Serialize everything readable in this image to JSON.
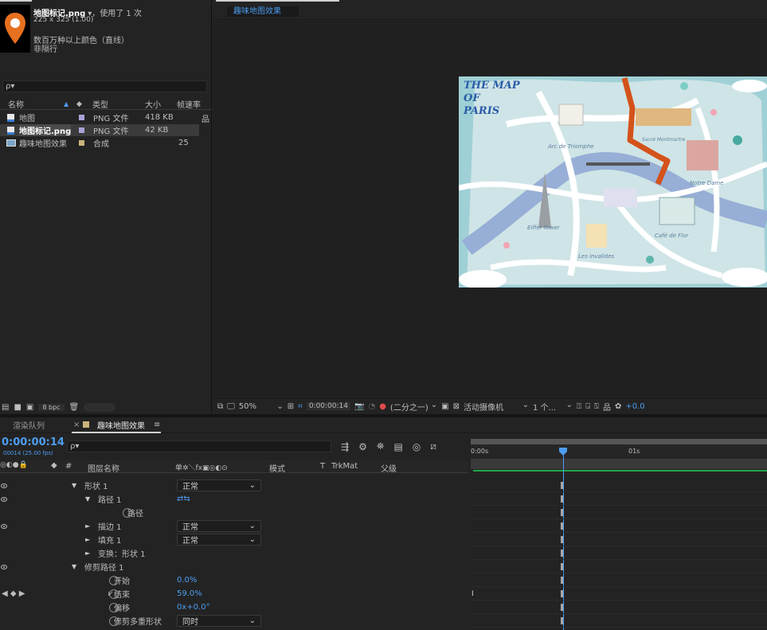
{
  "project": {
    "file_name": "地图标记.png",
    "used": "▾，使用了 1 次",
    "dims": "225 x 325 (1.00)",
    "desc1": "数百万种以上颜色（直线）",
    "desc2": "非隔行",
    "search_placeholder": "ρ▾",
    "columns": {
      "name": "名称",
      "type": "类型",
      "size": "大小",
      "fps": "帧速率"
    },
    "items": [
      {
        "name": "地图",
        "type": "PNG 文件",
        "size": "418 KB",
        "fps": ""
      },
      {
        "name": "地图标记.png",
        "type": "PNG 文件",
        "size": "42 KB",
        "fps": ""
      },
      {
        "name": "趣味地图效果",
        "type": "合成",
        "size": "",
        "fps": "25"
      }
    ],
    "bpc": "8 bpc"
  },
  "comp": {
    "tab": "趣味地图效果",
    "map_title": [
      "THE MAP",
      "OF",
      "PARIS"
    ],
    "map_labels": [
      "Arc de Triomphe",
      "Eiffel Tower",
      "Les invalides",
      "Café de Flor",
      "Notre Dame",
      "Sacré Montmartre"
    ],
    "zoom": "50%",
    "timecode": "0:00:00:14",
    "resolution": "(二分之一)",
    "camera": "活动摄像机",
    "views": "1 个...",
    "exposure": "+0.0"
  },
  "timeline": {
    "render_tab": "渲染队列",
    "comp_tab": "趣味地图效果",
    "time": "0:00:00:14",
    "frame": "00014 (25.00 fps)",
    "search_placeholder": "ρ▾",
    "header": {
      "hash": "#",
      "layer_name": "图层名称",
      "switches": "单✲＼fx▣◎◐⊙",
      "mode": "模式",
      "t": "T",
      "trkmat": "TrkMat",
      "parent": "父级"
    },
    "ruler": {
      "start": "0:00s",
      "one": "01s"
    },
    "layers": [
      {
        "indent": 1,
        "arrow": "▼",
        "name": "形状 1",
        "mode": "正常",
        "eye": true,
        "value": ""
      },
      {
        "indent": 2,
        "arrow": "▼",
        "name": "路径 1",
        "mode": "",
        "eye": true,
        "value": ""
      },
      {
        "indent": 3,
        "arrow": "",
        "name": "路径",
        "mode": "",
        "eye": false,
        "value": ""
      },
      {
        "indent": 2,
        "arrow": "►",
        "name": "描边 1",
        "mode": "正常",
        "eye": true,
        "value": ""
      },
      {
        "indent": 2,
        "arrow": "►",
        "name": "填充 1",
        "mode": "正常",
        "eye": false,
        "value": ""
      },
      {
        "indent": 2,
        "arrow": "►",
        "name": "变换：形状 1",
        "mode": "",
        "eye": false,
        "value": ""
      },
      {
        "indent": 1,
        "arrow": "▼",
        "name": "修剪路径 1",
        "mode": "",
        "eye": true,
        "value": ""
      },
      {
        "indent": 2,
        "arrow": "",
        "name": "开始",
        "mode": "",
        "eye": false,
        "value": "0.0%"
      },
      {
        "indent": 2,
        "arrow": "",
        "name": "结束",
        "mode": "",
        "eye": false,
        "value": "59.0%"
      },
      {
        "indent": 2,
        "arrow": "",
        "name": "偏移",
        "mode": "",
        "eye": false,
        "value": "0x+0.0°"
      },
      {
        "indent": 2,
        "arrow": "",
        "name": "修剪多重形状",
        "mode": "同时",
        "eye": false,
        "value": ""
      }
    ],
    "colors": {
      "accent": "#4d9df0",
      "route": "#d4521a",
      "green_bar": "#22a84a"
    }
  }
}
